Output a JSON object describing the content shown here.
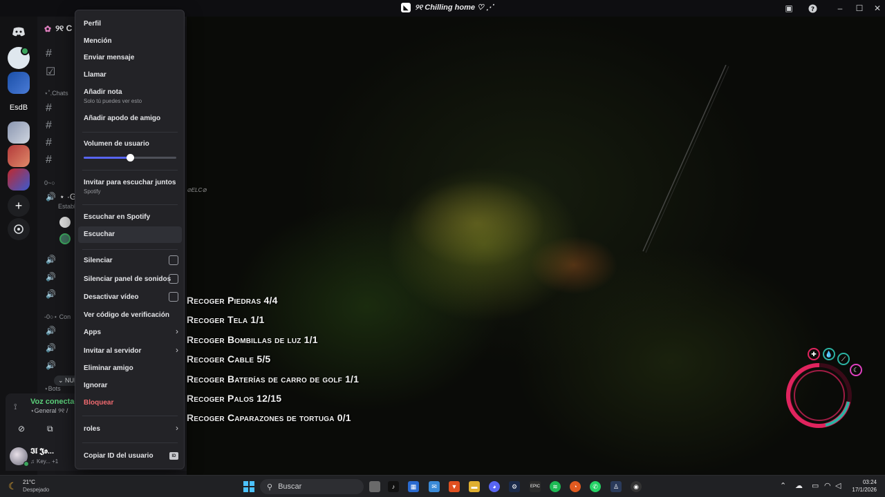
{
  "window": {
    "title": "୨୧ Chilling home ♡ ⋰"
  },
  "server_rail": {
    "esdb_label": "EsdB"
  },
  "channels": {
    "header": "୨୧ C",
    "category_chats": "⋆˚.Chats",
    "category_voice": "0~○ ",
    "category_conv": "-0○⋆ Con",
    "category_bots": "⋆Bots",
    "voice_channel_active": "⋆ ·G",
    "voice_status": "Establ",
    "nul_label": "NUL"
  },
  "voice_panel": {
    "status": "Voz conectac",
    "channel": "⋆General ୨୧ /"
  },
  "user_panel": {
    "name": "𝕴𝖑 𝕵𝖔...",
    "activity": "Key... +1"
  },
  "context_menu": {
    "profile": "Perfil",
    "mention": "Mención",
    "send_message": "Enviar mensaje",
    "call": "Llamar",
    "add_note": "Añadir nota",
    "add_note_sub": "Solo tú puedes ver esto",
    "add_nickname": "Añadir apodo de amigo",
    "user_volume": "Volumen de usuario",
    "user_volume_level": 0.5,
    "invite_listen": "Invitar para escuchar juntos",
    "invite_listen_sub": "Spotify",
    "listen_spotify": "Escuchar en Spotify",
    "listen": "Escuchar",
    "mute": "Silenciar",
    "mute_soundboard": "Silenciar panel de sonidos",
    "disable_video": "Desactivar vídeo",
    "verification_code": "Ver código de verificación",
    "apps": "Apps",
    "invite_server": "Invitar al servidor",
    "remove_friend": "Eliminar amigo",
    "ignore": "Ignorar",
    "block": "Bloquear",
    "roles": "roles",
    "copy_user_id": "Copiar ID del usuario",
    "id_badge": "ID"
  },
  "game": {
    "elc_tag": "⊘ELC⊘",
    "quests": [
      "Recoger Piedras 4/4",
      "Recoger Tela 1/1",
      "Recoger Bombillas de luz 1/1",
      "Recoger Cable 5/5",
      "Recoger Baterías de carro de golf 1/1",
      "Recoger Palos 12/15",
      "Recoger Caparazones de tortuga 0/1"
    ]
  },
  "taskbar": {
    "weather_temp": "21°C",
    "weather_desc": "Despejado",
    "search_placeholder": "Buscar",
    "time": "03:24",
    "date": "17/1/2026"
  },
  "colors": {
    "accent": "#5865f2",
    "danger": "#f06a6f",
    "hud_pink": "#e0245e",
    "hud_teal": "#2bb3a3"
  }
}
